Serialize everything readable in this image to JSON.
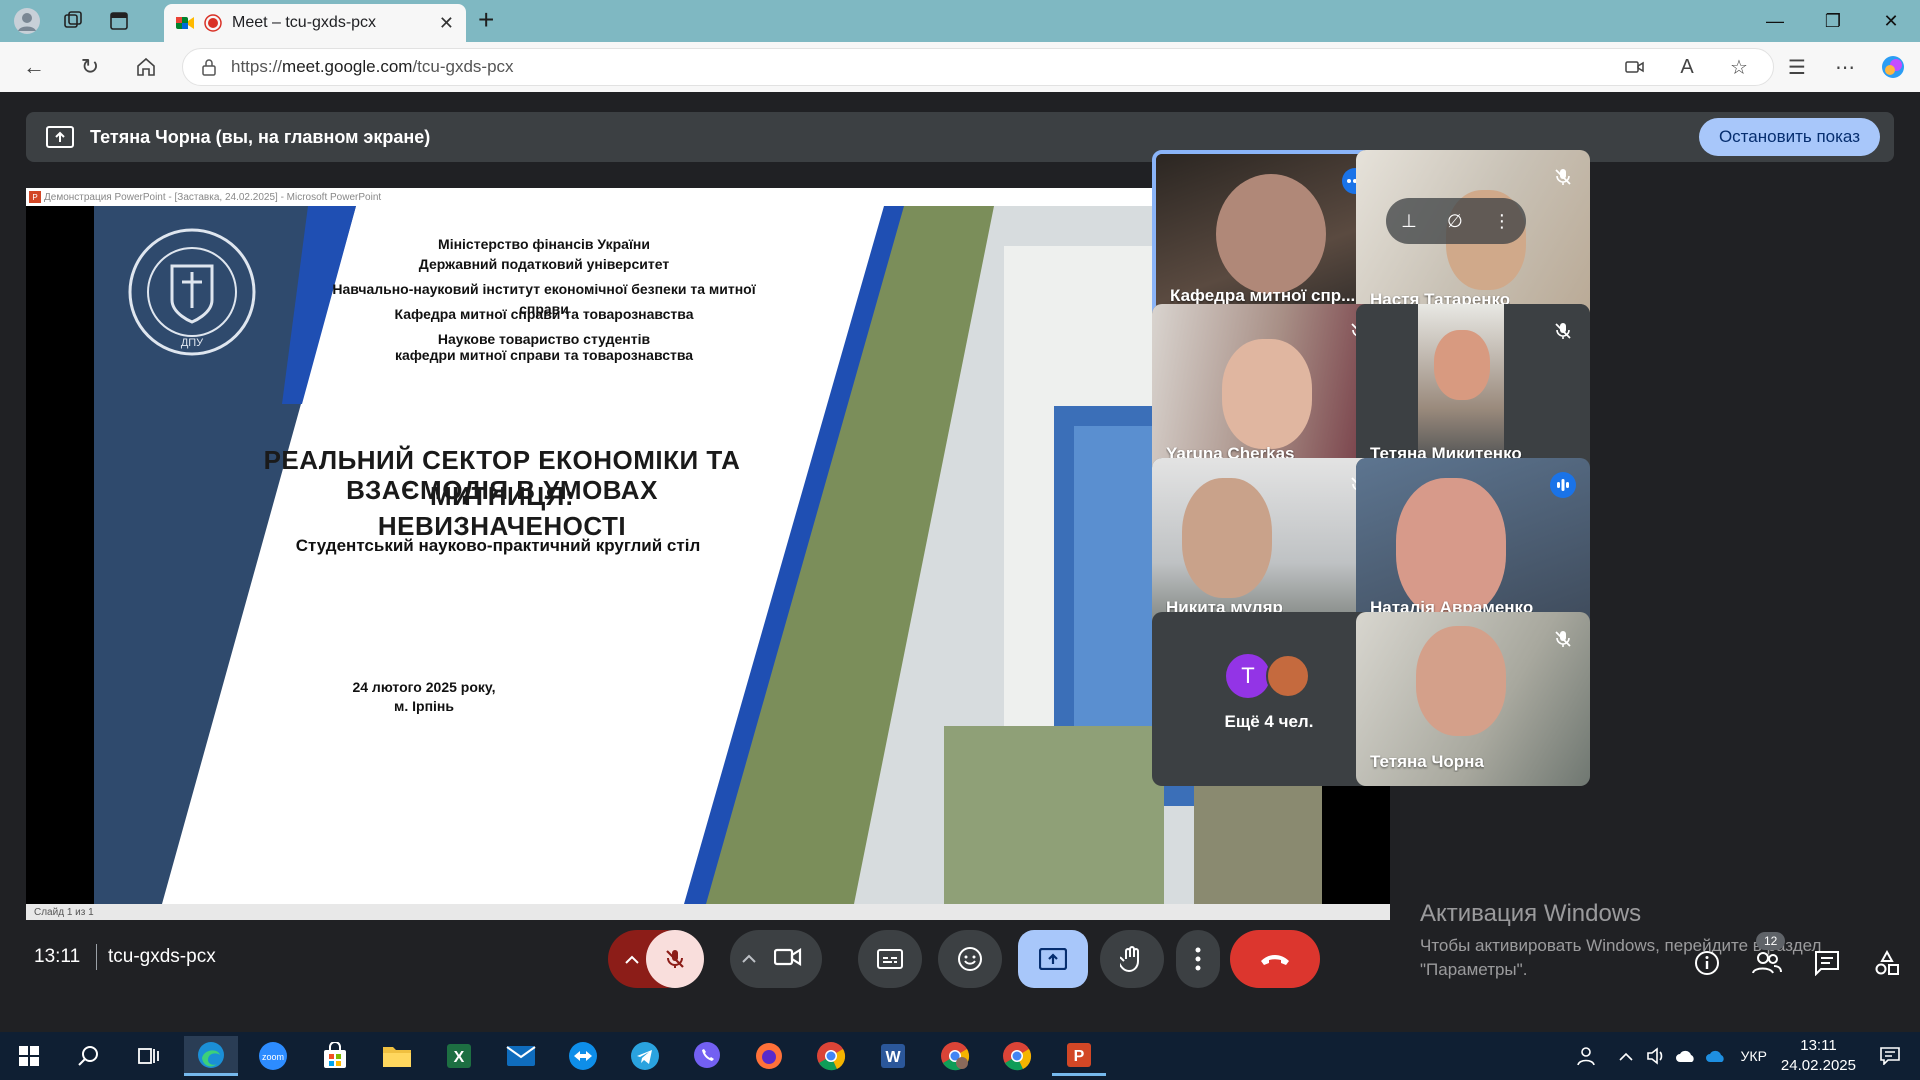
{
  "browser": {
    "tab_title": "Meet – tcu-gxds-pcx",
    "url_prefix": "https://",
    "url_host": "meet.google.com",
    "url_path": "/tcu-gxds-pcx"
  },
  "present_bar": {
    "label": "Тетяна Чорна (вы, на главном экране)",
    "stop_button": "Остановить показ"
  },
  "powerpoint": {
    "window_title": "Демонстрация PowerPoint - [Заставка, 24.02.2025] - Microsoft PowerPoint",
    "status": "Слайд 1 из 1"
  },
  "slide": {
    "line1": "Міністерство фінансів України",
    "line2": "Державний податковий університет",
    "line3": "Навчально-науковий інститут економічної безпеки та митної справи",
    "line4": "Кафедра митної справи та товарознавства",
    "line5": "Наукове товариство студентів",
    "line6": "кафедри митної справи та товарознавства",
    "title1": "РЕАЛЬНИЙ СЕКТОР ЕКОНОМІКИ ТА МИТНИЦЯ:",
    "title2": "ВЗАЄМОДІЯ В УМОВАХ НЕВИЗНАЧЕНОСТІ",
    "subtitle": "Студентський науково-практичний круглий стіл",
    "date": "24 лютого  2025 року,",
    "city": "м. Ірпінь",
    "seal_text": "ДПУ"
  },
  "participants": [
    {
      "name": "Кафедра митної спр...",
      "color": "#3a3430"
    },
    {
      "name": "Настя Татаренко",
      "color": "#c9c2b6"
    },
    {
      "name": "Yaruna Cherkas",
      "color": "#8e6f6a"
    },
    {
      "name": "Тетяна Микитенко",
      "color": "#575b60"
    },
    {
      "name": "Никита муляр",
      "color": "#6a6e72"
    },
    {
      "name": "Наталія Авраменко",
      "color": "#4d5b6e"
    },
    {
      "name": "Ещё 4 чел.",
      "avatar_letter": "T"
    },
    {
      "name": "Тетяна Чорна",
      "color": "#a8a89e"
    }
  ],
  "bottom": {
    "time": "13:11",
    "meeting_code": "tcu-gxds-pcx",
    "people_count": "12",
    "activation_title": "Активация Windows",
    "activation_text1": "Чтобы активировать Windows, перейдите в раздел",
    "activation_text2": "\"Параметры\"."
  },
  "taskbar": {
    "lang": "УКР",
    "clock_time": "13:11",
    "clock_date": "24.02.2025"
  }
}
